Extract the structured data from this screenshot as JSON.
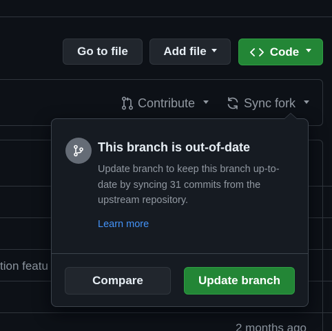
{
  "toolbar": {
    "go_to_file": "Go to file",
    "add_file": "Add file",
    "code": "Code"
  },
  "fork_bar": {
    "contribute": "Contribute",
    "sync_fork": "Sync fork"
  },
  "background": {
    "truncated_commit": "tion featu",
    "time_ago": "2 months ago"
  },
  "popover": {
    "title": "This branch is out-of-date",
    "description": "Update branch to keep this branch up-to-date by syncing 31 commits from the upstream repository.",
    "learn_more": "Learn more",
    "compare": "Compare",
    "update_branch": "Update branch"
  },
  "icons": {
    "code": "code-icon",
    "contribute": "git-pull-request-icon",
    "sync": "sync-icon",
    "branch": "git-branch-icon"
  },
  "colors": {
    "page_bg": "#0d1117",
    "popover_bg": "#161b22",
    "green": "#238636",
    "link": "#4493f8"
  }
}
